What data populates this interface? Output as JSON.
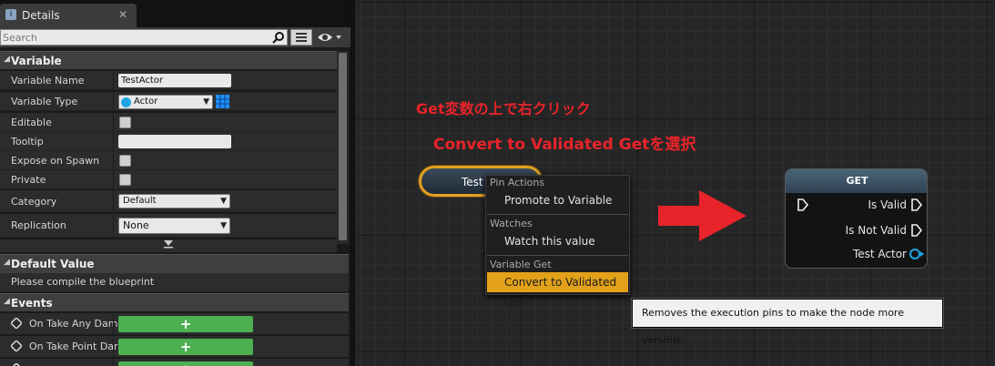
{
  "details": {
    "tab_title": "Details",
    "search_placeholder": "Search",
    "sections": {
      "variable": "Variable",
      "default_value": "Default Value",
      "events": "Events"
    },
    "properties": [
      {
        "label": "Variable Name",
        "value": "TestActor"
      },
      {
        "label": "Variable Type",
        "value": "Actor"
      },
      {
        "label": "Editable"
      },
      {
        "label": "Tooltip",
        "value": ""
      },
      {
        "label": "Expose on Spawn"
      },
      {
        "label": "Private"
      },
      {
        "label": "Category",
        "value": "Default"
      },
      {
        "label": "Replication",
        "value": "None"
      }
    ],
    "default_value_text": "Please compile the blueprint",
    "events": [
      "On Take Any Dam",
      "On Take Point Dar",
      ""
    ],
    "add_symbol": "+"
  },
  "graph": {
    "annotation_line1": "Get変数の上で右クリック",
    "annotation_line2": "Convert to Validated Getを選択",
    "var_node_label": "Test A",
    "context_menu": {
      "sections": [
        {
          "header": "Pin Actions",
          "items": [
            "Promote to Variable"
          ]
        },
        {
          "header": "Watches",
          "items": [
            "Watch this value"
          ]
        },
        {
          "header": "Variable Get",
          "items": [
            "Convert to Validated Get"
          ]
        }
      ]
    },
    "get_node": {
      "title": "GET",
      "pins": [
        "Is Valid",
        "Is Not Valid",
        "Test Actor"
      ]
    },
    "tooltip": "Removes the execution pins to make the node more versitile.",
    "colors": {
      "annotation": "#e8232a",
      "highlight": "#e3a11a",
      "object_pin": "#1ea7e6"
    }
  }
}
